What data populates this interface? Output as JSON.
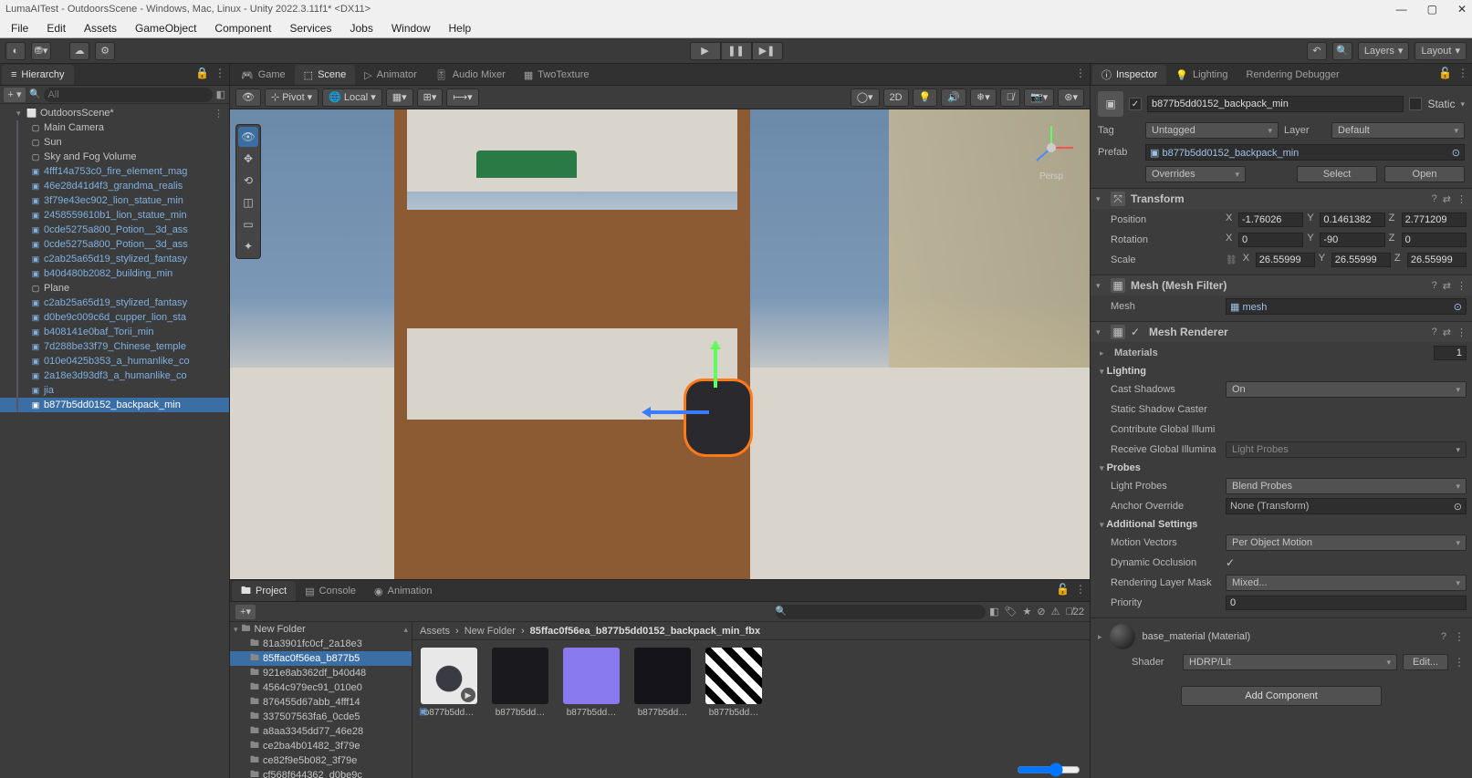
{
  "window": {
    "title": "LumaAITest - OutdoorsScene - Windows, Mac, Linux - Unity 2022.3.11f1* <DX11>"
  },
  "menu": {
    "items": [
      "File",
      "Edit",
      "Assets",
      "GameObject",
      "Component",
      "Services",
      "Jobs",
      "Window",
      "Help"
    ]
  },
  "top_toolbar": {
    "layers": "Layers",
    "layout": "Layout"
  },
  "hierarchy": {
    "tab": "Hierarchy",
    "search_placeholder": "All",
    "scene": "OutdoorsScene*",
    "items": [
      {
        "name": "Main Camera",
        "type": "go"
      },
      {
        "name": "Sun",
        "type": "go"
      },
      {
        "name": "Sky and Fog Volume",
        "type": "go"
      },
      {
        "name": "4fff14a753c0_fire_element_mag",
        "type": "prefab"
      },
      {
        "name": "46e28d41d4f3_grandma_realis",
        "type": "prefab"
      },
      {
        "name": "3f79e43ec902_lion_statue_min",
        "type": "prefab"
      },
      {
        "name": "2458559610b1_lion_statue_min",
        "type": "prefab"
      },
      {
        "name": "0cde5275a800_Potion__3d_ass",
        "type": "prefab"
      },
      {
        "name": "0cde5275a800_Potion__3d_ass",
        "type": "prefab"
      },
      {
        "name": "c2ab25a65d19_stylized_fantasy",
        "type": "prefab"
      },
      {
        "name": "b40d480b2082_building_min",
        "type": "prefab"
      },
      {
        "name": "Plane",
        "type": "go"
      },
      {
        "name": "c2ab25a65d19_stylized_fantasy",
        "type": "prefab"
      },
      {
        "name": "d0be9c009c6d_cupper_lion_sta",
        "type": "prefab"
      },
      {
        "name": "b408141e0baf_Torii_min",
        "type": "prefab"
      },
      {
        "name": "7d288be33f79_Chinese_temple",
        "type": "prefab"
      },
      {
        "name": "010e0425b353_a_humanlike_co",
        "type": "prefab"
      },
      {
        "name": "2a18e3d93df3_a_humanlike_co",
        "type": "prefab"
      },
      {
        "name": "jia",
        "type": "prefab"
      },
      {
        "name": "b877b5dd0152_backpack_min",
        "type": "prefab",
        "selected": true
      }
    ]
  },
  "scene_tabs": {
    "items": [
      {
        "label": "Game",
        "icon": "game"
      },
      {
        "label": "Scene",
        "icon": "scene",
        "active": true
      },
      {
        "label": "Animator",
        "icon": "animator"
      },
      {
        "label": "Audio Mixer",
        "icon": "audio"
      },
      {
        "label": "TwoTexture",
        "icon": "shader"
      }
    ]
  },
  "scene_toolbar": {
    "pivot": "Pivot",
    "local": "Local",
    "two_d": "2D",
    "persp": "Persp"
  },
  "bottom_tabs": {
    "items": [
      {
        "label": "Project",
        "active": true
      },
      {
        "label": "Console"
      },
      {
        "label": "Animation"
      }
    ]
  },
  "project": {
    "root_folder": "New Folder",
    "folders": [
      "81a3901fc0cf_2a18e3",
      "85ffac0f56ea_b877b5",
      "921e8ab362df_b40d48",
      "4564c979ec91_010e0",
      "876455d67abb_4fff14",
      "337507563fa6_0cde5",
      "a8aa3345dd77_46e28",
      "ce2ba4b01482_3f79e",
      "ce82f9e5b082_3f79e",
      "cf568f644362_d0be9c"
    ],
    "selected_folder_index": 1,
    "breadcrumb": [
      "Assets",
      "New Folder",
      "85ffac0f56ea_b877b5dd0152_backpack_min_fbx"
    ],
    "assets": [
      {
        "name": "b877b5dd…",
        "thumb": "backpack"
      },
      {
        "name": "b877b5dd…",
        "thumb": "normal"
      },
      {
        "name": "b877b5dd…",
        "thumb": "purple"
      },
      {
        "name": "b877b5dd…",
        "thumb": "dark"
      },
      {
        "name": "b877b5dd…",
        "thumb": "bw"
      }
    ],
    "hidden_count": "22"
  },
  "inspector_tabs": {
    "items": [
      {
        "label": "Inspector",
        "active": true
      },
      {
        "label": "Lighting"
      },
      {
        "label": "Rendering Debugger"
      }
    ]
  },
  "inspector": {
    "enabled": true,
    "name": "b877b5dd0152_backpack_min",
    "static_label": "Static",
    "tag_label": "Tag",
    "tag": "Untagged",
    "layer_label": "Layer",
    "layer": "Default",
    "prefab_label": "Prefab",
    "prefab": "b877b5dd0152_backpack_min",
    "overrides": "Overrides",
    "select": "Select",
    "open": "Open",
    "transform": {
      "title": "Transform",
      "position_label": "Position",
      "rotation_label": "Rotation",
      "scale_label": "Scale",
      "position": {
        "x": "-1.76026",
        "y": "0.1461382",
        "z": "2.771209"
      },
      "rotation": {
        "x": "0",
        "y": "-90",
        "z": "0"
      },
      "scale": {
        "x": "26.55999",
        "y": "26.55999",
        "z": "26.55999"
      }
    },
    "mesh_filter": {
      "title": "Mesh (Mesh Filter)",
      "mesh_label": "Mesh",
      "mesh": "mesh"
    },
    "mesh_renderer": {
      "title": "Mesh Renderer",
      "materials_label": "Materials",
      "materials_count": "1",
      "lighting_label": "Lighting",
      "cast_shadows_label": "Cast Shadows",
      "cast_shadows": "On",
      "static_shadow_label": "Static Shadow Caster",
      "contribute_gi_label": "Contribute Global Illumi",
      "receive_gi_label": "Receive Global Illumina",
      "receive_gi": "Light Probes",
      "probes_label": "Probes",
      "light_probes_label": "Light Probes",
      "light_probes": "Blend Probes",
      "anchor_label": "Anchor Override",
      "anchor": "None (Transform)",
      "additional_label": "Additional Settings",
      "motion_vectors_label": "Motion Vectors",
      "motion_vectors": "Per Object Motion",
      "dynamic_occ_label": "Dynamic Occlusion",
      "rendering_layer_label": "Rendering Layer Mask",
      "rendering_layer": "Mixed...",
      "priority_label": "Priority",
      "priority": "0"
    },
    "material": {
      "name": "base_material (Material)",
      "shader_label": "Shader",
      "shader": "HDRP/Lit",
      "edit": "Edit..."
    },
    "add_component": "Add Component"
  }
}
